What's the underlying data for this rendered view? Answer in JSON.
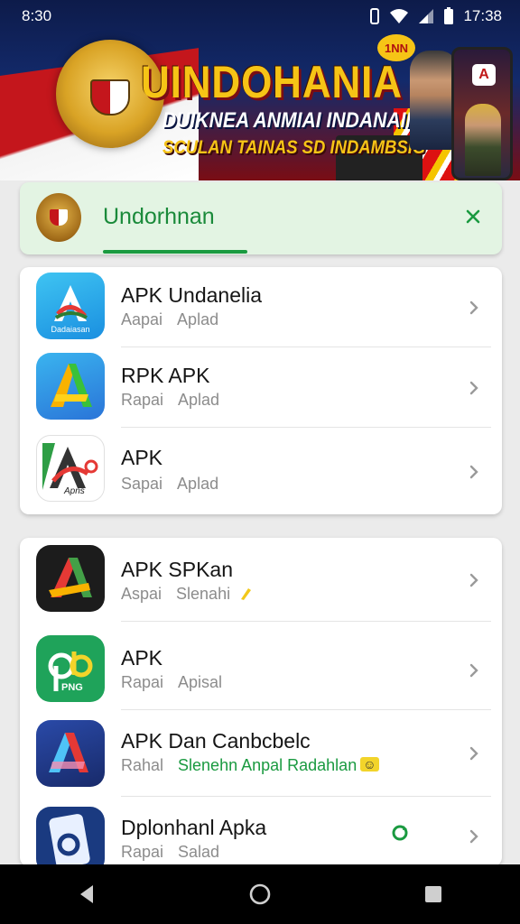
{
  "status_bar": {
    "time": "8:30",
    "clock_right": "17:38",
    "icons": [
      "vibrate-icon",
      "wifi-icon",
      "signal-icon",
      "battery-icon"
    ]
  },
  "banner": {
    "badge": "1NN",
    "title": "UINDOHANIA",
    "subtitle_1": "DUIKNEA ANMIAI INDANAIN",
    "subtitle_2": "SCULAN TAINAS SD INDAMBSIG",
    "phone_logo": "A"
  },
  "header": {
    "title": "Undorhnan",
    "accent_color": "#1a9a40",
    "background": "#e3f4e3"
  },
  "apps_group_1": [
    {
      "name": "APK Undanelia",
      "sub_1": "Aapai",
      "sub_2": "Aplad",
      "icon_text": "Dadaiasan",
      "icon": "apk-a-blue-icon"
    },
    {
      "name": "RPK APK",
      "sub_1": "Rapai",
      "sub_2": "Aplad",
      "icon": "apk-a-gradient-icon"
    },
    {
      "name": "APK",
      "sub_1": "Sapai",
      "sub_2": "Aplad",
      "icon_text": "Apns",
      "icon": "apk-a-white-icon"
    }
  ],
  "apps_group_2": [
    {
      "name": "APK SPKan",
      "sub_1": "Aspai",
      "sub_2": "Slenahi",
      "icon": "apk-a-dark-icon"
    },
    {
      "name": "APK",
      "sub_1": "Rapai",
      "sub_2": "Apisal",
      "icon_text": "PNG",
      "icon": "apk-pb-green-icon"
    },
    {
      "name": "APK Dan Canbcbelc",
      "sub_1": "Rahal",
      "sub_2": "Slenehn Anpal Radahlan",
      "icon": "apk-a-navy-icon"
    },
    {
      "name": "Dplonhanl Apka",
      "sub_1": "Rapai",
      "sub_2": "Salad",
      "icon": "apk-phone-icon"
    }
  ],
  "navbar": {
    "buttons": [
      "back-icon",
      "home-icon",
      "recents-icon"
    ]
  }
}
